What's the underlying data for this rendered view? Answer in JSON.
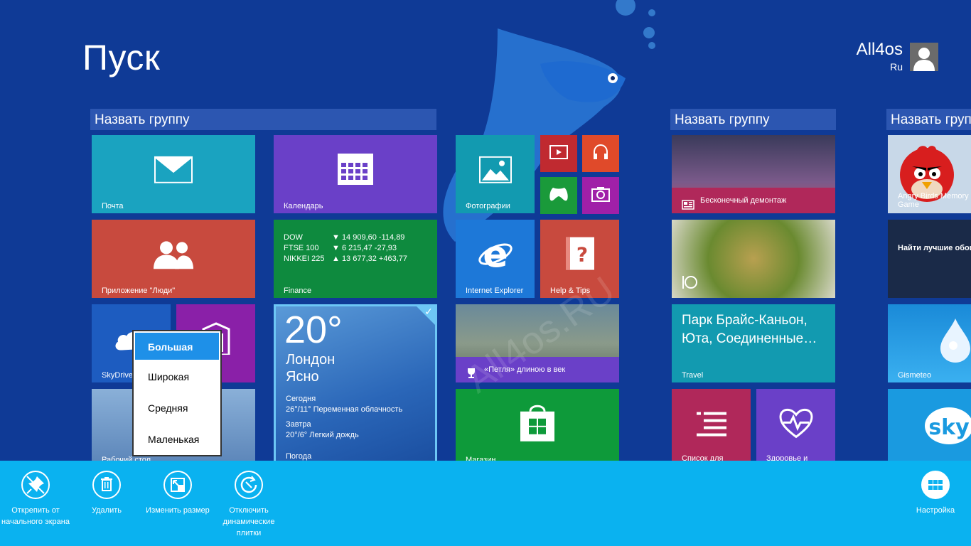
{
  "page": {
    "title": "Пуск"
  },
  "user": {
    "name": "All4os",
    "sub": "Ru"
  },
  "groups": [
    "Назвать группу",
    "Назвать группу",
    "Назвать группу"
  ],
  "tiles": {
    "mail": "Почта",
    "calendar": "Календарь",
    "photos": "Фотографии",
    "people": "Приложение \"Люди\"",
    "finance": "Finance",
    "ie": "Internet Explorer",
    "help": "Help & Tips",
    "skydrive": "SkyDrive",
    "desktop": "Рабочий стол",
    "weather": "Погода",
    "sport_news": "«Петля» длиною в век",
    "store": "Магазин",
    "news_top": "Бесконечный демонтаж",
    "travel_text": "Парк Брайс-Каньон, Юта, Соединенные…",
    "travel": "Travel",
    "reading": "Список для чтения",
    "health": "Здоровье и фитнес",
    "angry": "Angry Birds Memory Game",
    "find": "Найти лучшие обои",
    "gismeteo": "Gismeteo"
  },
  "finance": {
    "rows": [
      {
        "name": "DOW",
        "value": "▼ 14 909,60 -114,89"
      },
      {
        "name": "FTSE 100",
        "value": "▼ 6 215,47 -27,93"
      },
      {
        "name": "NIKKEI 225",
        "value": "▲ 13 677,32 +463,77"
      }
    ]
  },
  "weather": {
    "temp": "20°",
    "city": "Лондон",
    "condition": "Ясно",
    "today_label": "Сегодня",
    "today": "26°/11° Переменная облачность",
    "tomorrow_label": "Завтра",
    "tomorrow": "20°/6° Легкий дождь"
  },
  "resize_menu": {
    "items": [
      "Большая",
      "Широкая",
      "Средняя",
      "Маленькая"
    ],
    "selected": "Большая"
  },
  "appbar": {
    "unpin": "Открепить от начального экрана",
    "delete": "Удалить",
    "resize": "Изменить размер",
    "live": "Отключить динамические плитки",
    "settings": "Настройка"
  },
  "watermark": "All4os.RU",
  "colors": {
    "background": "#0f3a96",
    "appbar": "#0ab2f0",
    "mail": "#1aa3c0",
    "calendar": "#6a40c8",
    "people": "#c84a3e",
    "finance": "#0e8a3e",
    "ie": "#1d78d8",
    "help": "#c84a3e",
    "store": "#0e9a3a",
    "travel": "#129ab0",
    "reading": "#b0285a",
    "health": "#6a40c8"
  }
}
